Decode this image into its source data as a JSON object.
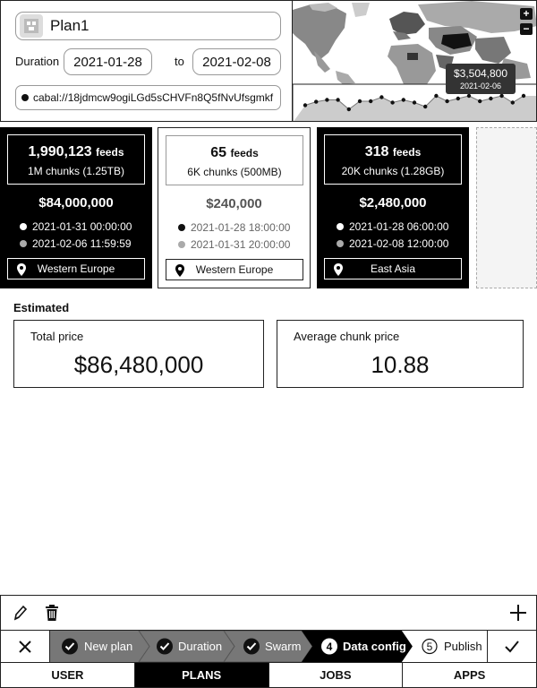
{
  "plan": {
    "name": "Plan1",
    "duration_label": "Duration",
    "start_date": "2021-01-28",
    "to_label": "to",
    "end_date": "2021-02-08",
    "address": "cabal://18jdmcw9ogiLGd5sCHVFn8Q5fNvUfsgmkf"
  },
  "map": {
    "zoom_in": "+",
    "zoom_out": "−",
    "tooltip_value": "$3,504,800",
    "tooltip_date": "2021-02-06",
    "sparkline_values": [
      0.55,
      0.42,
      0.35,
      0.35,
      0.7,
      0.4,
      0.4,
      0.25,
      0.45,
      0.35,
      0.45,
      0.6,
      0.2,
      0.4,
      0.3,
      0.2,
      0.4,
      0.3,
      0.2,
      0.45,
      0.2
    ]
  },
  "cards": [
    {
      "style": "dark",
      "feeds_value": "1,990,123",
      "feeds_unit": "feeds",
      "chunks": "1M chunks (1.25TB)",
      "price": "$84,000,000",
      "start_time": "2021-01-31 00:00:00",
      "end_time": "2021-02-06 11:59:59",
      "region": "Western Europe"
    },
    {
      "style": "light",
      "feeds_value": "65",
      "feeds_unit": "feeds",
      "chunks": "6K chunks (500MB)",
      "price": "$240,000",
      "start_time": "2021-01-28 18:00:00",
      "end_time": "2021-01-31 20:00:00",
      "region": "Western Europe"
    },
    {
      "style": "dark",
      "feeds_value": "318",
      "feeds_unit": "feeds",
      "chunks": "20K chunks (1.28GB)",
      "price": "$2,480,000",
      "start_time": "2021-01-28 06:00:00",
      "end_time": "2021-02-08 12:00:00",
      "region": "East Asia"
    }
  ],
  "estimated": {
    "title": "Estimated",
    "total_label": "Total price",
    "total_value": "$86,480,000",
    "avg_label": "Average chunk price",
    "avg_value": "10.88"
  },
  "wizard": {
    "steps": [
      {
        "label": "New plan",
        "status": "done"
      },
      {
        "label": "Duration",
        "status": "done"
      },
      {
        "label": "Swarm",
        "status": "done"
      },
      {
        "label": "Data config",
        "number": "4",
        "status": "active"
      },
      {
        "label": "Publish",
        "number": "5",
        "status": "pending"
      }
    ]
  },
  "tabs": [
    "USER",
    "PLANS",
    "JOBS",
    "APPS"
  ],
  "active_tab": "PLANS",
  "icons": {
    "edit": "pencil-icon",
    "delete": "trash-icon",
    "add": "plus-icon",
    "close": "close-icon",
    "confirm": "check-icon",
    "location": "map-pin-icon"
  }
}
